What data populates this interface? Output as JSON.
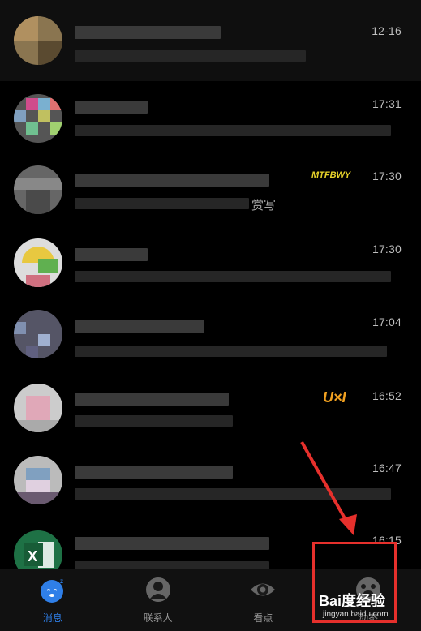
{
  "conversations": [
    {
      "time": "12-16",
      "pinned": true
    },
    {
      "time": "17:31"
    },
    {
      "time": "17:30",
      "badge": "MTFBWY",
      "snippet": "赏写"
    },
    {
      "time": "17:30"
    },
    {
      "time": "17:04"
    },
    {
      "time": "16:52",
      "badge": "U×I"
    },
    {
      "time": "16:47"
    },
    {
      "time": "16:15"
    }
  ],
  "tabs": [
    {
      "label": "消息",
      "icon": "message-icon",
      "active": true
    },
    {
      "label": "联系人",
      "icon": "contacts-icon"
    },
    {
      "label": "看点",
      "icon": "eye-icon"
    },
    {
      "label": "动态",
      "icon": "paw-icon"
    }
  ],
  "watermark": {
    "text": "Bai度经验",
    "url": "jingyan.baidu.com"
  },
  "colors": {
    "accent": "#2f7fe8",
    "highlight": "#e6302c",
    "badge1": "#e8d32a",
    "badge2": "#f0a020"
  }
}
